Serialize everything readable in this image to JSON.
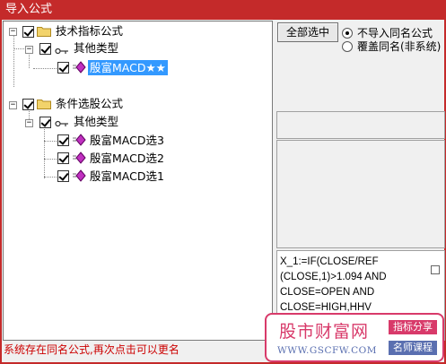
{
  "window": {
    "title": "导入公式"
  },
  "tree": {
    "group1": {
      "label": "技术指标公式",
      "sub": {
        "label": "其他类型",
        "items": [
          "殷富MACD★★"
        ]
      }
    },
    "group2": {
      "label": "条件选股公式",
      "sub": {
        "label": "其他类型",
        "items": [
          "殷富MACD选3",
          "殷富MACD选2",
          "殷富MACD选1"
        ]
      }
    }
  },
  "controls": {
    "select_all_label": "全部选中",
    "radio_no_import": "不导入同名公式",
    "radio_overwrite": "覆盖同名(非系统)"
  },
  "formula_text": [
    "X_1:=IF(CLOSE/REF",
    "(CLOSE,1)>1.094 AND",
    "CLOSE=OPEN AND",
    "CLOSE=HIGH,HHV"
  ],
  "watermark": {
    "title": "股市财富网",
    "url": "WWW.GSCFW.COM",
    "tag1": "指标分享",
    "tag2": "名师课程"
  },
  "status_text": "系统存在同名公式,再次点击可以更名",
  "colors": {
    "titlebar": "#c42a2a",
    "selection": "#3399ff",
    "status": "#cc0000",
    "watermark_pink": "#d83a6a",
    "watermark_blue": "#5a6fb0"
  }
}
